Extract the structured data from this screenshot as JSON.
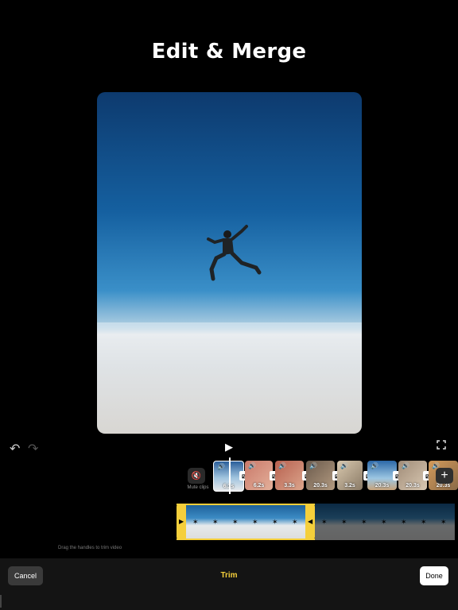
{
  "header": {
    "title": "Edit & Merge"
  },
  "player": {
    "play_icon": "play-icon",
    "fullscreen_icon": "fullscreen-icon"
  },
  "history": {
    "undo_icon": "undo-icon",
    "redo_icon": "redo-icon"
  },
  "mute": {
    "label": "Mute clips",
    "icon": "speaker-muted-icon"
  },
  "clips": [
    {
      "duration": "6.1s",
      "color": "#4a7db0"
    },
    {
      "duration": "6.2s",
      "color": "#c9796a"
    },
    {
      "duration": "3.3s",
      "color": "#b7604f"
    },
    {
      "duration": "20.3s",
      "color": "#7a6a5a"
    },
    {
      "duration": "3.2s",
      "color": "#c8b69c"
    },
    {
      "duration": "20.3s",
      "color": "#3d78b5"
    },
    {
      "duration": "20.3s",
      "color": "#a08c78"
    },
    {
      "duration": "20.3s",
      "color": "#d39a5a"
    }
  ],
  "trim": {
    "hint": "Drag the handles to trim video",
    "selected_fraction": 0.49
  },
  "footer": {
    "cancel_label": "Cancel",
    "mode_label": "Trim",
    "done_label": "Done"
  },
  "colors": {
    "accent": "#f5cf3b",
    "background": "#000000"
  }
}
